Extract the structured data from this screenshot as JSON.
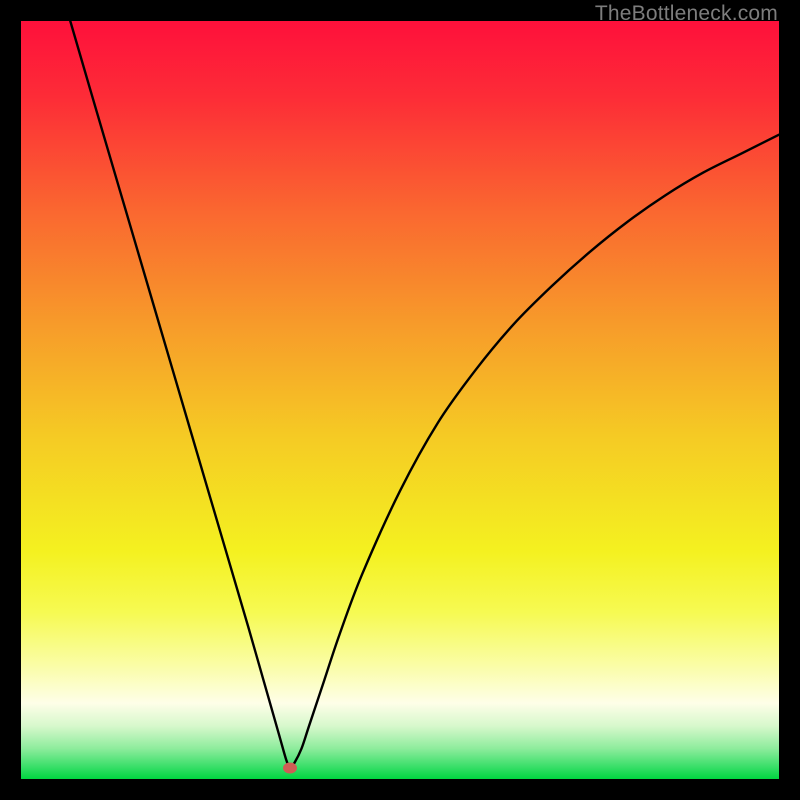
{
  "watermark": "TheBottleneck.com",
  "chart_data": {
    "type": "line",
    "title": "",
    "xlabel": "",
    "ylabel": "",
    "xlim": [
      0,
      100
    ],
    "ylim": [
      0,
      100
    ],
    "grid": false,
    "legend": false,
    "series": [
      {
        "name": "curve",
        "x": [
          6.5,
          10,
          15,
          20,
          25,
          30,
          32,
          34,
          35,
          35.5,
          36,
          37,
          38,
          40,
          42,
          45,
          50,
          55,
          60,
          65,
          70,
          75,
          80,
          85,
          90,
          95,
          100
        ],
        "y": [
          100,
          88,
          71,
          54,
          37,
          20,
          13,
          6,
          2.5,
          1.5,
          2,
          4,
          7,
          13,
          19,
          27,
          38,
          47,
          54,
          60,
          65,
          69.5,
          73.5,
          77,
          80,
          82.5,
          85
        ]
      }
    ],
    "marker": {
      "x": 35.5,
      "y": 1.4,
      "color": "#cf5d55"
    },
    "gradient_stops": [
      {
        "pos": 0.0,
        "color": "#fe103b"
      },
      {
        "pos": 0.1,
        "color": "#fd2c37"
      },
      {
        "pos": 0.25,
        "color": "#fa6730"
      },
      {
        "pos": 0.4,
        "color": "#f79b2a"
      },
      {
        "pos": 0.55,
        "color": "#f5cb24"
      },
      {
        "pos": 0.7,
        "color": "#f4f120"
      },
      {
        "pos": 0.78,
        "color": "#f6fa52"
      },
      {
        "pos": 0.85,
        "color": "#fafda6"
      },
      {
        "pos": 0.9,
        "color": "#fefee8"
      },
      {
        "pos": 0.93,
        "color": "#d7f8cc"
      },
      {
        "pos": 0.96,
        "color": "#8dec9c"
      },
      {
        "pos": 0.985,
        "color": "#35de66"
      },
      {
        "pos": 1.0,
        "color": "#01d640"
      }
    ]
  }
}
